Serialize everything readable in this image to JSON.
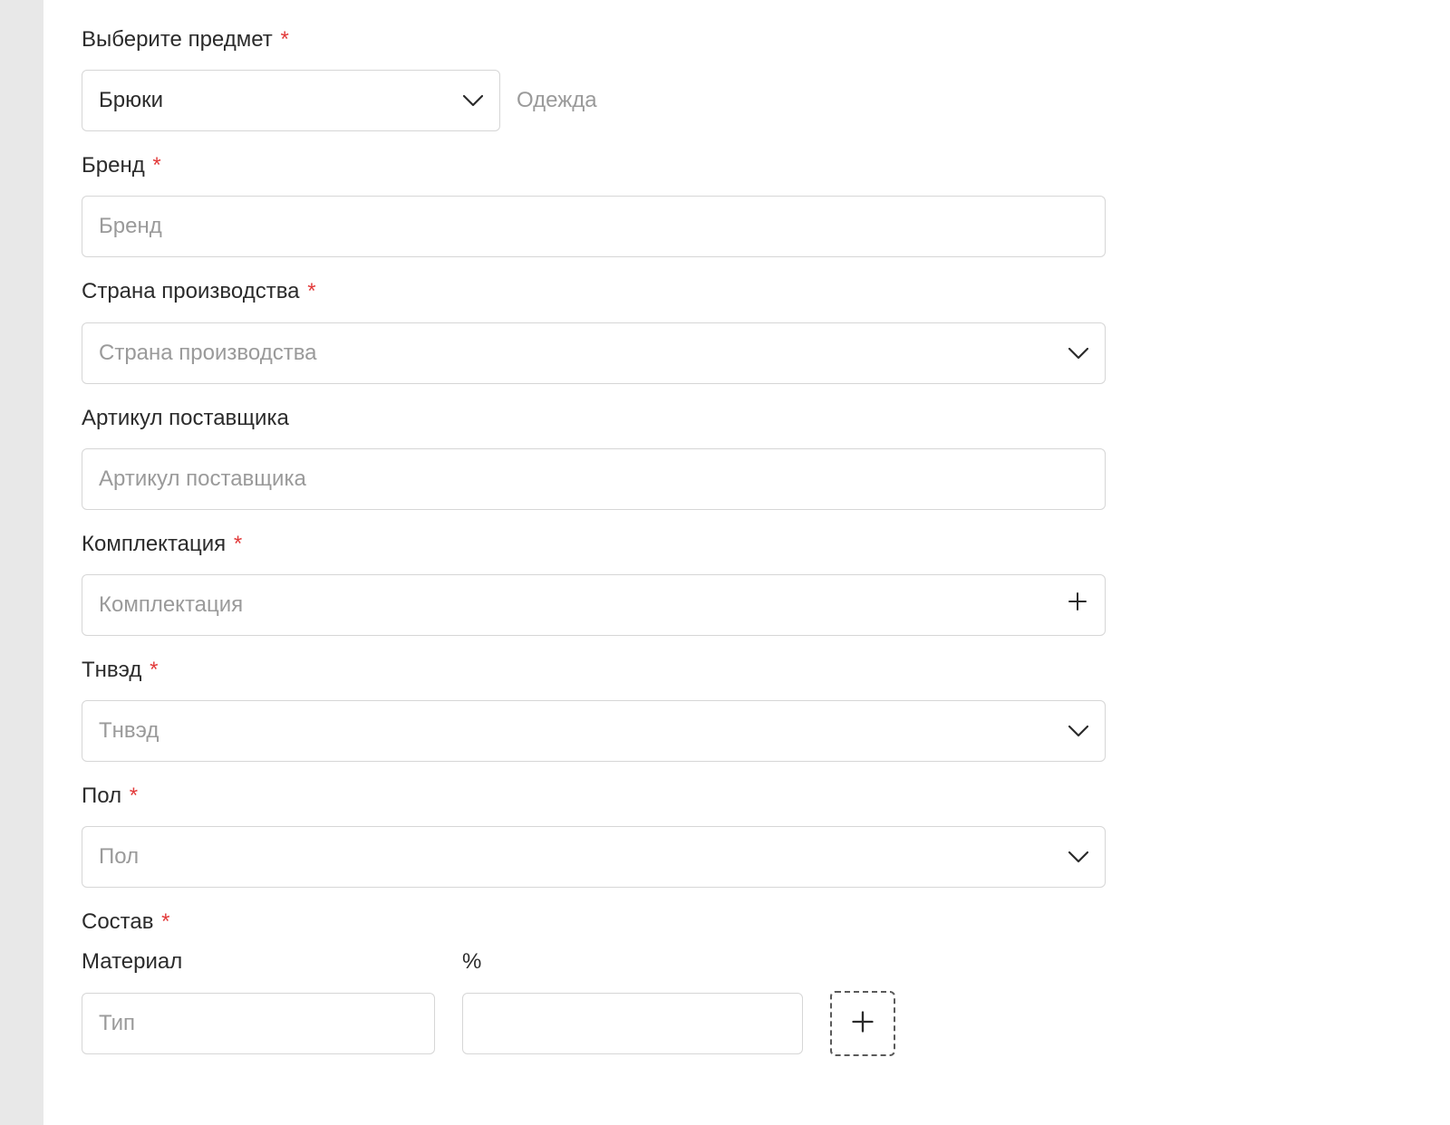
{
  "subject": {
    "label": "Выберите предмет",
    "required": true,
    "value": "Брюки",
    "category": "Одежда"
  },
  "brand": {
    "label": "Бренд",
    "required": true,
    "placeholder": "Бренд"
  },
  "country": {
    "label": "Страна производства",
    "required": true,
    "placeholder": "Страна производства"
  },
  "supplier_sku": {
    "label": "Артикул поставщика",
    "required": false,
    "placeholder": "Артикул поставщика"
  },
  "kit": {
    "label": "Комплектация",
    "required": true,
    "placeholder": "Комплектация"
  },
  "tnved": {
    "label": "Тнвэд",
    "required": true,
    "placeholder": "Тнвэд"
  },
  "gender": {
    "label": "Пол",
    "required": true,
    "placeholder": "Пол"
  },
  "composition": {
    "label": "Состав",
    "required": true,
    "material_label": "Материал",
    "percent_label": "%",
    "material_placeholder": "Тип"
  },
  "asterisk": "*"
}
